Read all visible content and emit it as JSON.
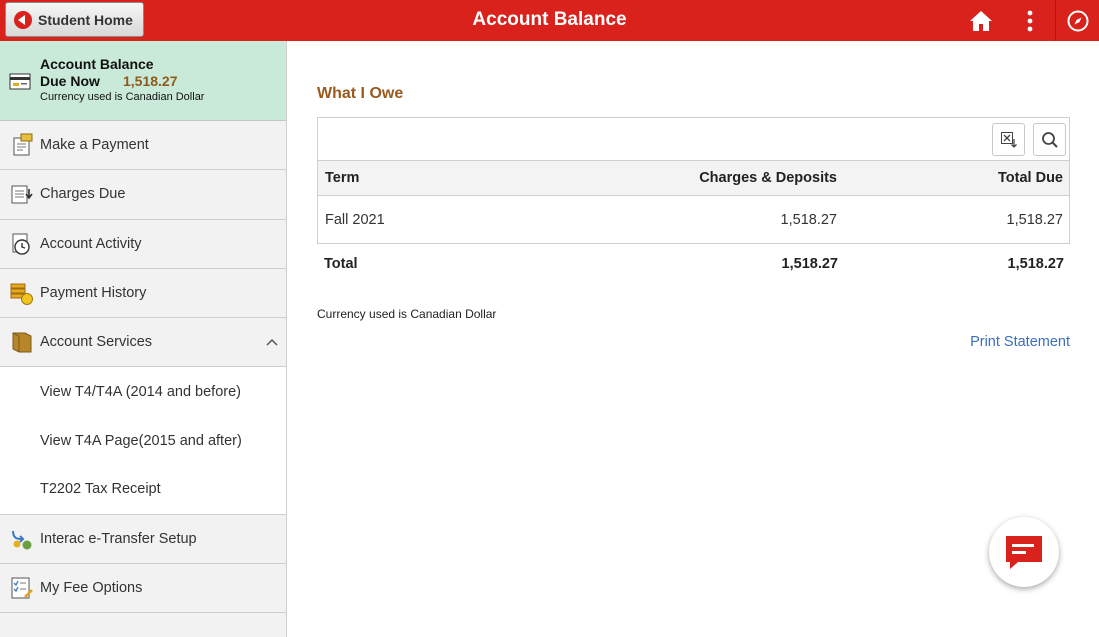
{
  "header": {
    "back_label": "Student Home",
    "title": "Account Balance",
    "brand_color": "#d9221c",
    "icons": [
      "home-icon",
      "more-vertical-icon",
      "navbar-compass-icon"
    ]
  },
  "sidebar": {
    "summary": {
      "title": "Account Balance",
      "due_label": "Due Now",
      "due_value": "1,518.27",
      "currency": "Currency used is Canadian Dollar"
    },
    "items": [
      {
        "label": "Make a Payment",
        "icon": "payment-form-icon"
      },
      {
        "label": "Charges Due",
        "icon": "charges-due-icon"
      },
      {
        "label": "Account Activity",
        "icon": "account-activity-icon"
      },
      {
        "label": "Payment History",
        "icon": "payment-history-coins-icon"
      },
      {
        "label": "Account Services",
        "icon": "folder-icon",
        "expanded": true
      },
      {
        "label": "Interac e-Transfer Setup",
        "icon": "interac-transfer-icon"
      },
      {
        "label": "My Fee Options",
        "icon": "fee-options-checklist-icon"
      }
    ],
    "sub_items": [
      {
        "label": "View T4/T4A (2014 and before)"
      },
      {
        "label": "View T4A Page(2015 and after)"
      },
      {
        "label": "T2202 Tax Receipt"
      }
    ]
  },
  "main": {
    "section_title": "What I Owe",
    "columns": [
      "Term",
      "Charges & Deposits",
      "Total Due"
    ],
    "rows": [
      {
        "term": "Fall 2021",
        "charges": "1,518.27",
        "total_due": "1,518.27"
      }
    ],
    "totals": {
      "label": "Total",
      "charges": "1,518.27",
      "total_due": "1,518.27"
    },
    "currency_note": "Currency used is Canadian Dollar",
    "print_link": "Print Statement",
    "accent_color": "#9a5a1e",
    "link_color": "#3a6fc0"
  },
  "fab": {
    "icon": "chat-message-icon"
  }
}
